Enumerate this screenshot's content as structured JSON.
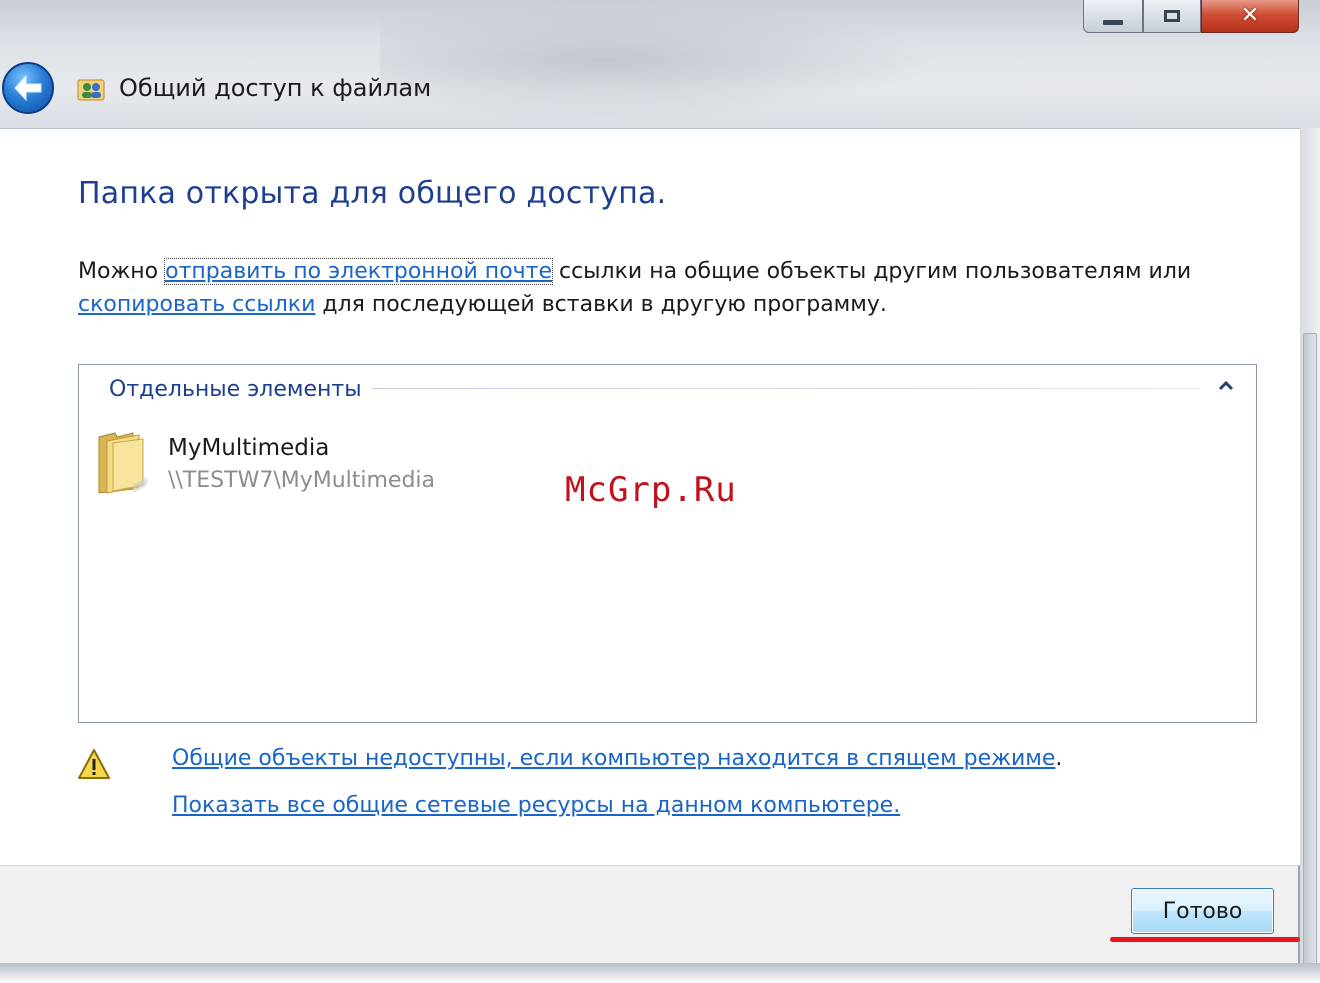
{
  "window": {
    "title": "Общий доступ к файлам",
    "controls": {
      "minimize": "—",
      "maximize": "□",
      "close": "✕"
    }
  },
  "content": {
    "heading": "Папка открыта для общего доступа.",
    "intro_prefix": "Можно ",
    "email_link": "отправить по электронной почте",
    "intro_middle": " ссылки на общие объекты другим пользователям или ",
    "copy_link": "скопировать ссылки",
    "intro_suffix": " для последующей вставки в другую программу."
  },
  "items_group": {
    "header": "Отдельные элементы",
    "items": [
      {
        "name": "MyMultimedia",
        "path": "\\\\TESTW7\\MyMultimedia",
        "icon": "folder-icon"
      }
    ]
  },
  "watermark": "McGrp.Ru",
  "links": {
    "sleep_warning": "Общие объекты недоступны, если компьютер находится в спящем режиме",
    "sleep_warning_period": ".",
    "show_all": "Показать все общие сетевые ресурсы на данном компьютере."
  },
  "footer": {
    "done_button": "Готово"
  },
  "colors": {
    "heading": "#1e3f91",
    "link": "#1a65c8",
    "accent_underline": "#e8141e",
    "watermark": "#c3101e"
  }
}
